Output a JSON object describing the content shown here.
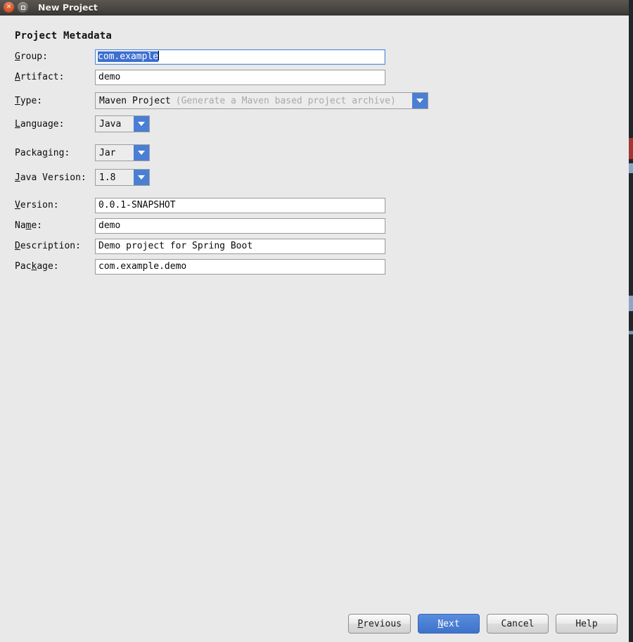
{
  "window": {
    "title": "New Project",
    "close_icon": "close-icon",
    "maximize_icon": "maximize-icon"
  },
  "section": {
    "title": "Project Metadata"
  },
  "fields": {
    "group": {
      "label_pre": "",
      "label_mnemonic": "G",
      "label_post": "roup:",
      "value": "com.example",
      "selected": true
    },
    "artifact": {
      "label_pre": "",
      "label_mnemonic": "A",
      "label_post": "rtifact:",
      "value": "demo"
    },
    "type": {
      "label_pre": "",
      "label_mnemonic": "T",
      "label_post": "ype:",
      "value": "Maven Project",
      "hint": "(Generate a Maven based project archive)"
    },
    "language": {
      "label_pre": "",
      "label_mnemonic": "L",
      "label_post": "anguage:",
      "value": "Java"
    },
    "packaging": {
      "label_pre": "Packa",
      "label_mnemonic": "g",
      "label_post": "ing:",
      "value": "Jar"
    },
    "java_version": {
      "label_pre": "",
      "label_mnemonic": "J",
      "label_post": "ava Version:",
      "value": "1.8"
    },
    "version": {
      "label_pre": "",
      "label_mnemonic": "V",
      "label_post": "ersion:",
      "value": "0.0.1-SNAPSHOT"
    },
    "name": {
      "label_pre": "Na",
      "label_mnemonic": "m",
      "label_post": "e:",
      "value": "demo"
    },
    "description": {
      "label_pre": "",
      "label_mnemonic": "D",
      "label_post": "escription:",
      "value": "Demo project for Spring Boot"
    },
    "package": {
      "label_pre": "Pac",
      "label_mnemonic": "k",
      "label_post": "age:",
      "value": "com.example.demo"
    }
  },
  "buttons": {
    "previous": {
      "pre": "",
      "mnemonic": "P",
      "post": "revious"
    },
    "next": {
      "pre": "",
      "mnemonic": "N",
      "post": "ext"
    },
    "cancel": {
      "pre": "Cancel",
      "mnemonic": "",
      "post": ""
    },
    "help": {
      "pre": "Help",
      "mnemonic": "",
      "post": ""
    }
  },
  "colors": {
    "accent_blue": "#4a7fd4",
    "selection_blue": "#3d6fd0",
    "focus_border": "#5f92d9",
    "window_bg": "#e9e9e9",
    "titlebar_dark": "#4b4843",
    "close_button_red": "#d8552b"
  }
}
